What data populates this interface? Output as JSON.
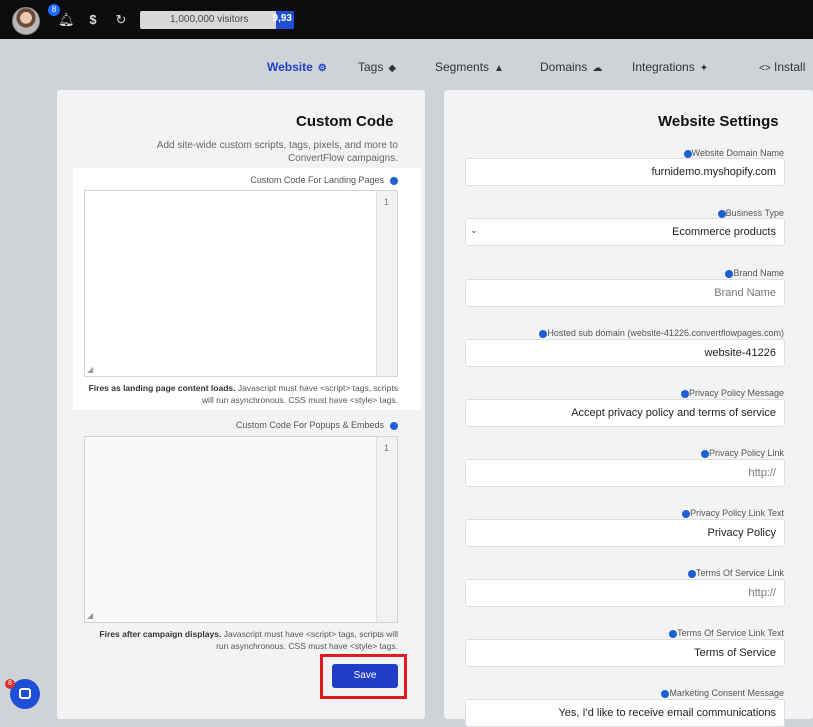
{
  "topbar": {
    "avatar_badge": "8",
    "visitors_count": "9,93",
    "visitors_limit": "1,000,000 visitors",
    "visitors_used_fraction": 0.12
  },
  "tabs": [
    {
      "label": "Install",
      "icon": "code-icon"
    },
    {
      "label": "Integrations",
      "icon": "puzzle-icon"
    },
    {
      "label": "Domains",
      "icon": "cloud-icon"
    },
    {
      "label": "Segments",
      "icon": "user-icon"
    },
    {
      "label": "Tags",
      "icon": "tag-icon"
    },
    {
      "label": "Website",
      "icon": "gear-icon"
    }
  ],
  "website_settings": {
    "title": "Website Settings",
    "fields": [
      {
        "label": "Website Domain Name",
        "value": "furnidemo.myshopify.com"
      },
      {
        "label": "Business Type",
        "value": "Ecommerce products"
      },
      {
        "label": "Brand Name",
        "placeholder": "Brand Name"
      },
      {
        "label": "Hosted sub domain (website-41226.convertflowpages.com)",
        "value": "website-41226"
      },
      {
        "label": "Privacy Policy Message",
        "value": "Accept privacy policy and terms of service"
      },
      {
        "label": "Privacy Policy Link",
        "placeholder": "http://"
      },
      {
        "label": "Privacy Policy Link Text",
        "value": "Privacy Policy"
      },
      {
        "label": "Terms Of Service Link",
        "placeholder": "http://"
      },
      {
        "label": "Terms Of Service Link Text",
        "value": "Terms of Service"
      },
      {
        "label": "Marketing Consent Message",
        "value": "Yes, I'd like to receive email communications"
      }
    ]
  },
  "custom_code": {
    "title": "Custom Code",
    "description": "Add site-wide custom scripts, tags, pixels, and more to ConvertFlow campaigns.",
    "landing_label": "Custom Code For Landing Pages",
    "landing_line": "1",
    "landing_note_bold": "Fires as landing page content loads.",
    "landing_note": "Javascript must have <script> tags, scripts will run asynchronous. CSS must have <style> tags.",
    "popups_label": "Custom Code For Popups & Embeds",
    "popups_line": "1",
    "popups_note_bold": "Fires after campaign displays.",
    "popups_note": "Javascript must have <script> tags, scripts will run asynchronous. CSS must have <style> tags.",
    "save_label": "Save"
  },
  "chat": {
    "badge": "8"
  },
  "colors": {
    "accent": "#1f3fc9",
    "highlight": "#e01b1b",
    "topbar": "#0b0c0e"
  }
}
